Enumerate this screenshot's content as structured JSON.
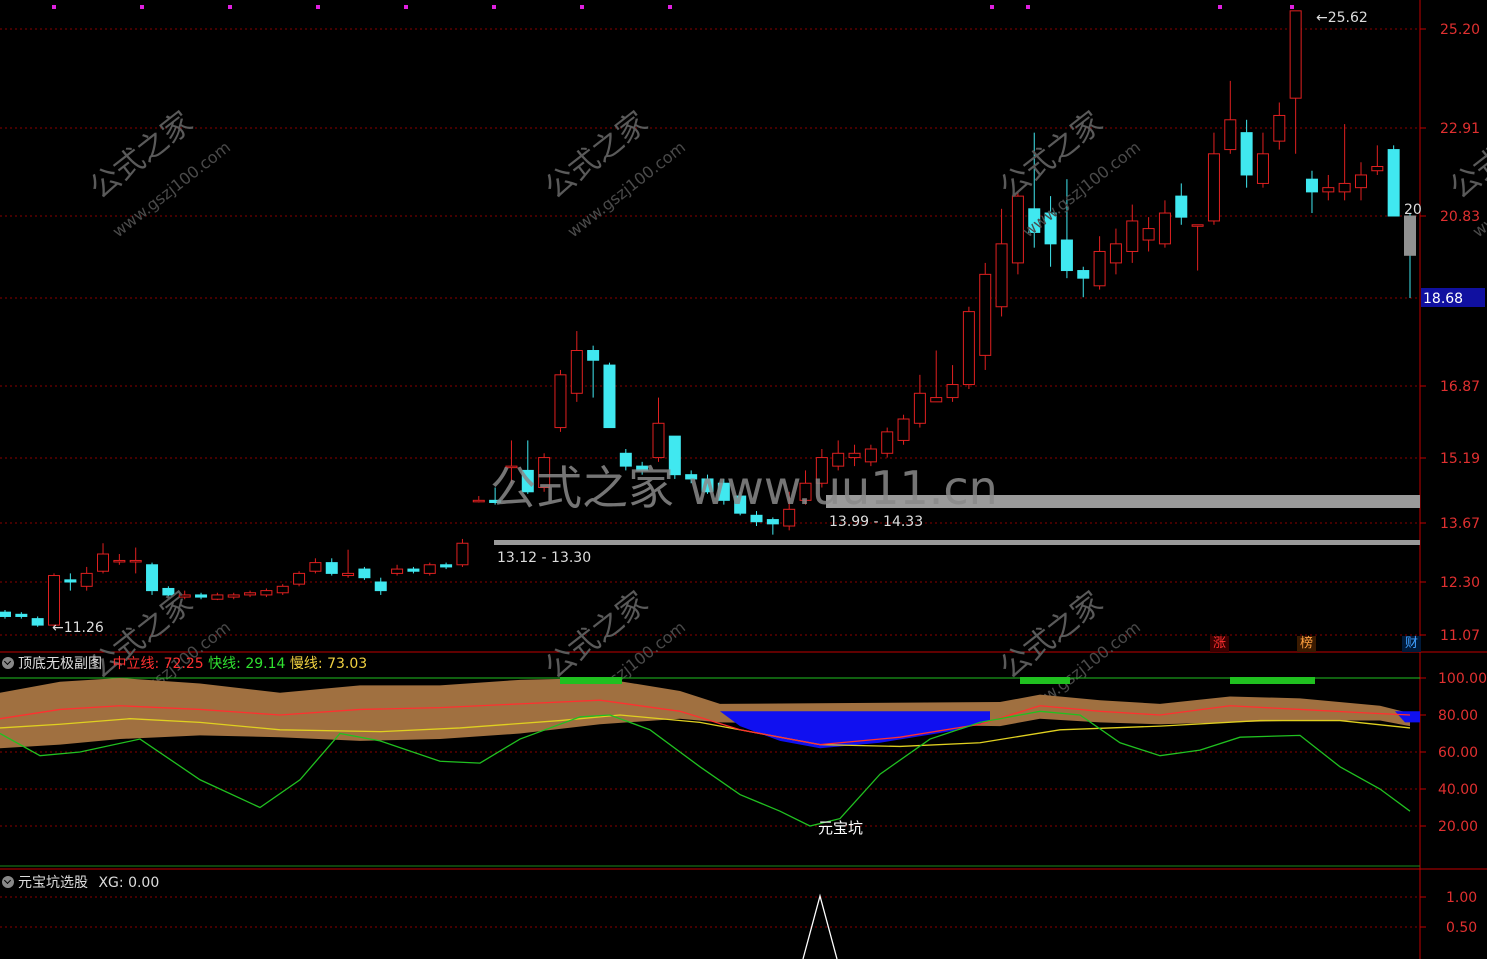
{
  "main": {
    "price_ticks": [
      "25.20",
      "22.91",
      "20.83",
      "16.87",
      "15.19",
      "13.67",
      "12.30",
      "11.07"
    ],
    "current_price": "18.68",
    "annotations": {
      "high": "25.62",
      "low": "11.26",
      "zone1": "13.12 - 13.30",
      "zone2": "13.99 - 14.33",
      "side": "20"
    },
    "badges": [
      "涨",
      "榜",
      "财"
    ],
    "watermark_large": "公式之家 www.uu11.cn",
    "watermark_small": "公式之家",
    "watermark_url": "www.gszj100.com",
    "candles": [
      [
        11.6,
        11.5,
        11.65,
        11.45
      ],
      [
        11.55,
        11.5,
        11.6,
        11.45
      ],
      [
        11.45,
        11.3,
        11.5,
        11.26
      ],
      [
        11.3,
        12.45,
        12.5,
        11.28
      ],
      [
        12.35,
        12.3,
        12.5,
        12.1
      ],
      [
        12.2,
        12.5,
        12.65,
        12.1
      ],
      [
        12.55,
        12.95,
        13.2,
        12.5
      ],
      [
        12.8,
        12.8,
        12.95,
        12.7
      ],
      [
        12.8,
        12.8,
        13.1,
        12.5
      ],
      [
        12.7,
        12.1,
        12.75,
        12.0
      ],
      [
        12.15,
        12.0,
        12.2,
        11.95
      ],
      [
        11.95,
        12.0,
        12.1,
        11.9
      ],
      [
        12.0,
        11.95,
        12.05,
        11.9
      ],
      [
        11.9,
        12.0,
        12.05,
        11.88
      ],
      [
        11.95,
        12.0,
        12.05,
        11.9
      ],
      [
        12.0,
        12.05,
        12.1,
        11.95
      ],
      [
        12.0,
        12.1,
        12.15,
        11.95
      ],
      [
        12.05,
        12.2,
        12.25,
        12.0
      ],
      [
        12.25,
        12.5,
        12.55,
        12.2
      ],
      [
        12.55,
        12.75,
        12.85,
        12.5
      ],
      [
        12.75,
        12.5,
        12.85,
        12.45
      ],
      [
        12.45,
        12.5,
        13.05,
        12.4
      ],
      [
        12.6,
        12.4,
        12.65,
        12.35
      ],
      [
        12.3,
        12.1,
        12.4,
        12.0
      ],
      [
        12.5,
        12.6,
        12.7,
        12.45
      ],
      [
        12.6,
        12.55,
        12.65,
        12.5
      ],
      [
        12.5,
        12.7,
        12.75,
        12.45
      ],
      [
        12.7,
        12.65,
        12.75,
        12.6
      ],
      [
        12.7,
        13.2,
        13.3,
        12.65
      ],
      [
        14.2,
        14.2,
        14.3,
        14.15
      ],
      [
        14.2,
        14.15,
        14.5,
        14.1
      ],
      [
        15.0,
        15.0,
        15.6,
        14.6
      ],
      [
        14.9,
        14.4,
        15.6,
        14.35
      ],
      [
        14.5,
        15.2,
        15.3,
        14.4
      ],
      [
        15.9,
        17.1,
        17.2,
        15.8
      ],
      [
        16.7,
        17.6,
        18.0,
        16.5
      ],
      [
        17.6,
        17.4,
        17.7,
        16.6
      ],
      [
        17.3,
        15.9,
        17.35,
        15.9
      ],
      [
        15.3,
        15.0,
        15.4,
        14.9
      ],
      [
        15.0,
        14.9,
        15.1,
        14.8
      ],
      [
        15.2,
        16.0,
        16.6,
        15.1
      ],
      [
        15.7,
        14.8,
        15.7,
        14.7
      ],
      [
        14.8,
        14.7,
        14.9,
        14.6
      ],
      [
        14.7,
        14.4,
        14.8,
        14.35
      ],
      [
        14.6,
        14.2,
        14.7,
        14.1
      ],
      [
        14.3,
        13.9,
        14.4,
        13.85
      ],
      [
        13.85,
        13.7,
        13.95,
        13.6
      ],
      [
        13.75,
        13.65,
        13.8,
        13.4
      ],
      [
        13.6,
        13.99,
        14.4,
        13.5
      ],
      [
        14.2,
        14.6,
        14.9,
        14.1
      ],
      [
        14.6,
        15.2,
        15.4,
        14.5
      ],
      [
        15.0,
        15.3,
        15.6,
        14.9
      ],
      [
        15.2,
        15.3,
        15.5,
        15.0
      ],
      [
        15.1,
        15.4,
        15.5,
        15.0
      ],
      [
        15.3,
        15.8,
        15.9,
        15.2
      ],
      [
        15.6,
        16.1,
        16.2,
        15.5
      ],
      [
        16.0,
        16.7,
        17.1,
        15.9
      ],
      [
        16.5,
        16.6,
        17.6,
        16.5
      ],
      [
        16.6,
        16.9,
        17.3,
        16.5
      ],
      [
        16.9,
        18.4,
        18.5,
        16.8
      ],
      [
        17.5,
        19.3,
        19.6,
        17.2
      ],
      [
        18.5,
        20.1,
        21.0,
        18.3
      ],
      [
        19.6,
        21.3,
        21.4,
        19.3
      ],
      [
        21.0,
        20.4,
        22.8,
        20.0
      ],
      [
        20.9,
        20.1,
        21.3,
        19.5
      ],
      [
        20.2,
        19.4,
        21.7,
        19.2
      ],
      [
        19.4,
        19.2,
        19.5,
        18.7
      ],
      [
        19.0,
        19.9,
        20.3,
        18.9
      ],
      [
        19.6,
        20.1,
        20.5,
        19.3
      ],
      [
        19.9,
        20.7,
        21.1,
        19.6
      ],
      [
        20.2,
        20.5,
        20.8,
        19.9
      ],
      [
        20.1,
        20.9,
        21.2,
        20.0
      ],
      [
        21.3,
        20.8,
        21.6,
        20.6
      ],
      [
        20.6,
        20.6,
        20.6,
        19.4
      ],
      [
        20.7,
        22.3,
        22.8,
        20.6
      ],
      [
        22.4,
        23.1,
        24.0,
        22.3
      ],
      [
        22.8,
        21.8,
        23.1,
        21.5
      ],
      [
        21.6,
        22.3,
        22.8,
        21.5
      ],
      [
        22.6,
        23.2,
        23.5,
        22.4
      ],
      [
        23.6,
        25.62,
        25.62,
        22.3
      ],
      [
        21.7,
        21.4,
        21.9,
        20.9
      ],
      [
        21.4,
        21.5,
        21.8,
        21.2
      ],
      [
        21.4,
        21.6,
        23.0,
        21.2
      ],
      [
        21.5,
        21.8,
        22.1,
        21.2
      ],
      [
        21.9,
        22.0,
        22.5,
        21.8
      ],
      [
        22.4,
        20.83,
        22.5,
        20.83
      ],
      [
        20.83,
        19.8,
        20.9,
        18.68
      ]
    ]
  },
  "sub1": {
    "title": "顶底无极副图",
    "items": [
      {
        "label": "中立线: ",
        "value": "72.25"
      },
      {
        "label": "快线: ",
        "value": "29.14"
      },
      {
        "label": "慢线: ",
        "value": "73.03"
      }
    ],
    "ticks": [
      "100.00",
      "80.00",
      "60.00",
      "40.00",
      "20.00"
    ],
    "marker": "元宝坑"
  },
  "sub2": {
    "title": "元宝坑选股",
    "items": [
      {
        "label": "XG: ",
        "value": "0.00"
      }
    ],
    "ticks": [
      "1.00",
      "0.50"
    ]
  },
  "colors": {
    "up": "#e02020",
    "down": "#40e8f0",
    "grid": "#8a0000",
    "axis": "#c00000",
    "fast": "#20c020",
    "slow": "#e0d020",
    "mid": "#ff3030",
    "band": "#a07040",
    "blue": "#1010f0"
  }
}
